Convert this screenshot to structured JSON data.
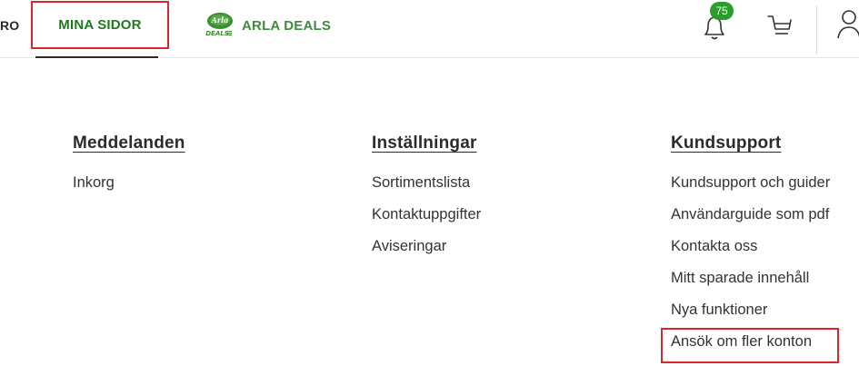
{
  "nav": {
    "partial_label": "RO",
    "mina_sidor": "MINA SIDOR",
    "arla_deals": "ARLA DEALS",
    "logo_text": "Arla",
    "logo_sub": "DEALS",
    "notification_count": "75",
    "icons": [
      "bell-icon",
      "cart-icon",
      "user-icon"
    ],
    "accent_green": "#1f7a1f",
    "highlight_red": "#d9262c"
  },
  "menu": {
    "columns": [
      {
        "title": "Meddelanden",
        "items": [
          "Inkorg"
        ]
      },
      {
        "title": "Inställningar",
        "items": [
          "Sortimentslista",
          "Kontaktuppgifter",
          "Aviseringar"
        ]
      },
      {
        "title": "Kundsupport",
        "items": [
          "Kundsupport och guider",
          "Användarguide som pdf",
          "Kontakta oss",
          "Mitt sparade innehåll",
          "Nya funktioner",
          "Ansök om fler konton"
        ]
      }
    ]
  }
}
